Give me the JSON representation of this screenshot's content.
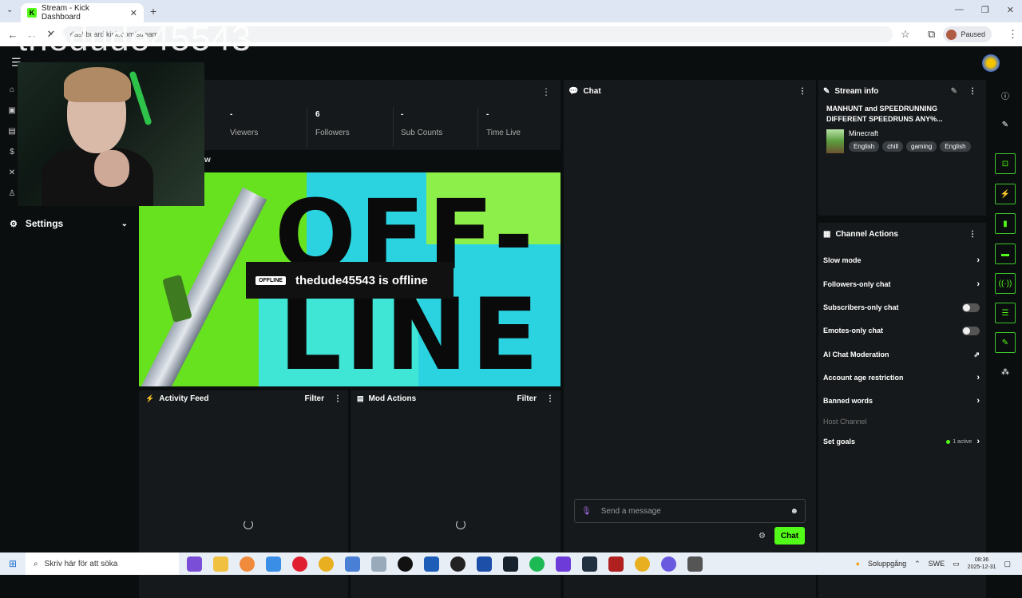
{
  "browser": {
    "tab_title": "Stream - Kick Dashboard",
    "url": "dashboard.kick.com/stream",
    "paused_label": "Paused"
  },
  "overlay_title": "thedude45543",
  "stats": [
    {
      "value": "-",
      "label": "Viewers"
    },
    {
      "value": "6",
      "label": "Followers"
    },
    {
      "value": "-",
      "label": "Sub Counts"
    },
    {
      "value": "-",
      "label": "Time Live"
    }
  ],
  "stream_label": "w",
  "player": {
    "big_text_1": "OFF-",
    "big_text_2": "LINE",
    "badge": "OFFLINE",
    "status": "thedude45543 is offline"
  },
  "sidebar": {
    "settings_label": "Settings"
  },
  "activity_feed": {
    "title": "Activity Feed",
    "filter": "Filter"
  },
  "mod_actions": {
    "title": "Mod Actions",
    "filter": "Filter"
  },
  "chat": {
    "title": "Chat",
    "placeholder": "Send a message",
    "send_label": "Chat"
  },
  "stream_info": {
    "title": "Stream info",
    "stream_title": "MANHUNT and SPEEDRUNNING DIFFERENT SPEEDRUNS ANY%...",
    "category": "Minecraft",
    "tags": [
      "English",
      "chill",
      "gaming",
      "English"
    ]
  },
  "channel_actions": {
    "title": "Channel Actions",
    "items": [
      {
        "label": "Slow mode",
        "control": "chevron"
      },
      {
        "label": "Followers-only chat",
        "control": "chevron"
      },
      {
        "label": "Subscribers-only chat",
        "control": "toggle"
      },
      {
        "label": "Emotes-only chat",
        "control": "toggle"
      },
      {
        "label": "AI Chat Moderation",
        "control": "external"
      },
      {
        "label": "Account age restriction",
        "control": "chevron"
      },
      {
        "label": "Banned words",
        "control": "chevron"
      },
      {
        "label": "Host Channel",
        "control": "none"
      },
      {
        "label": "Set goals",
        "control": "chevron"
      }
    ],
    "goals_status": "1 active"
  },
  "taskbar": {
    "search_placeholder": "Skriv här för att söka",
    "weather": "Soluppgång",
    "lang": "SWE",
    "time": "08:36",
    "date": "2025-12-31"
  },
  "colors": {
    "accent": "#53fc18",
    "panel": "#16191b",
    "background": "#0b0e0f"
  }
}
